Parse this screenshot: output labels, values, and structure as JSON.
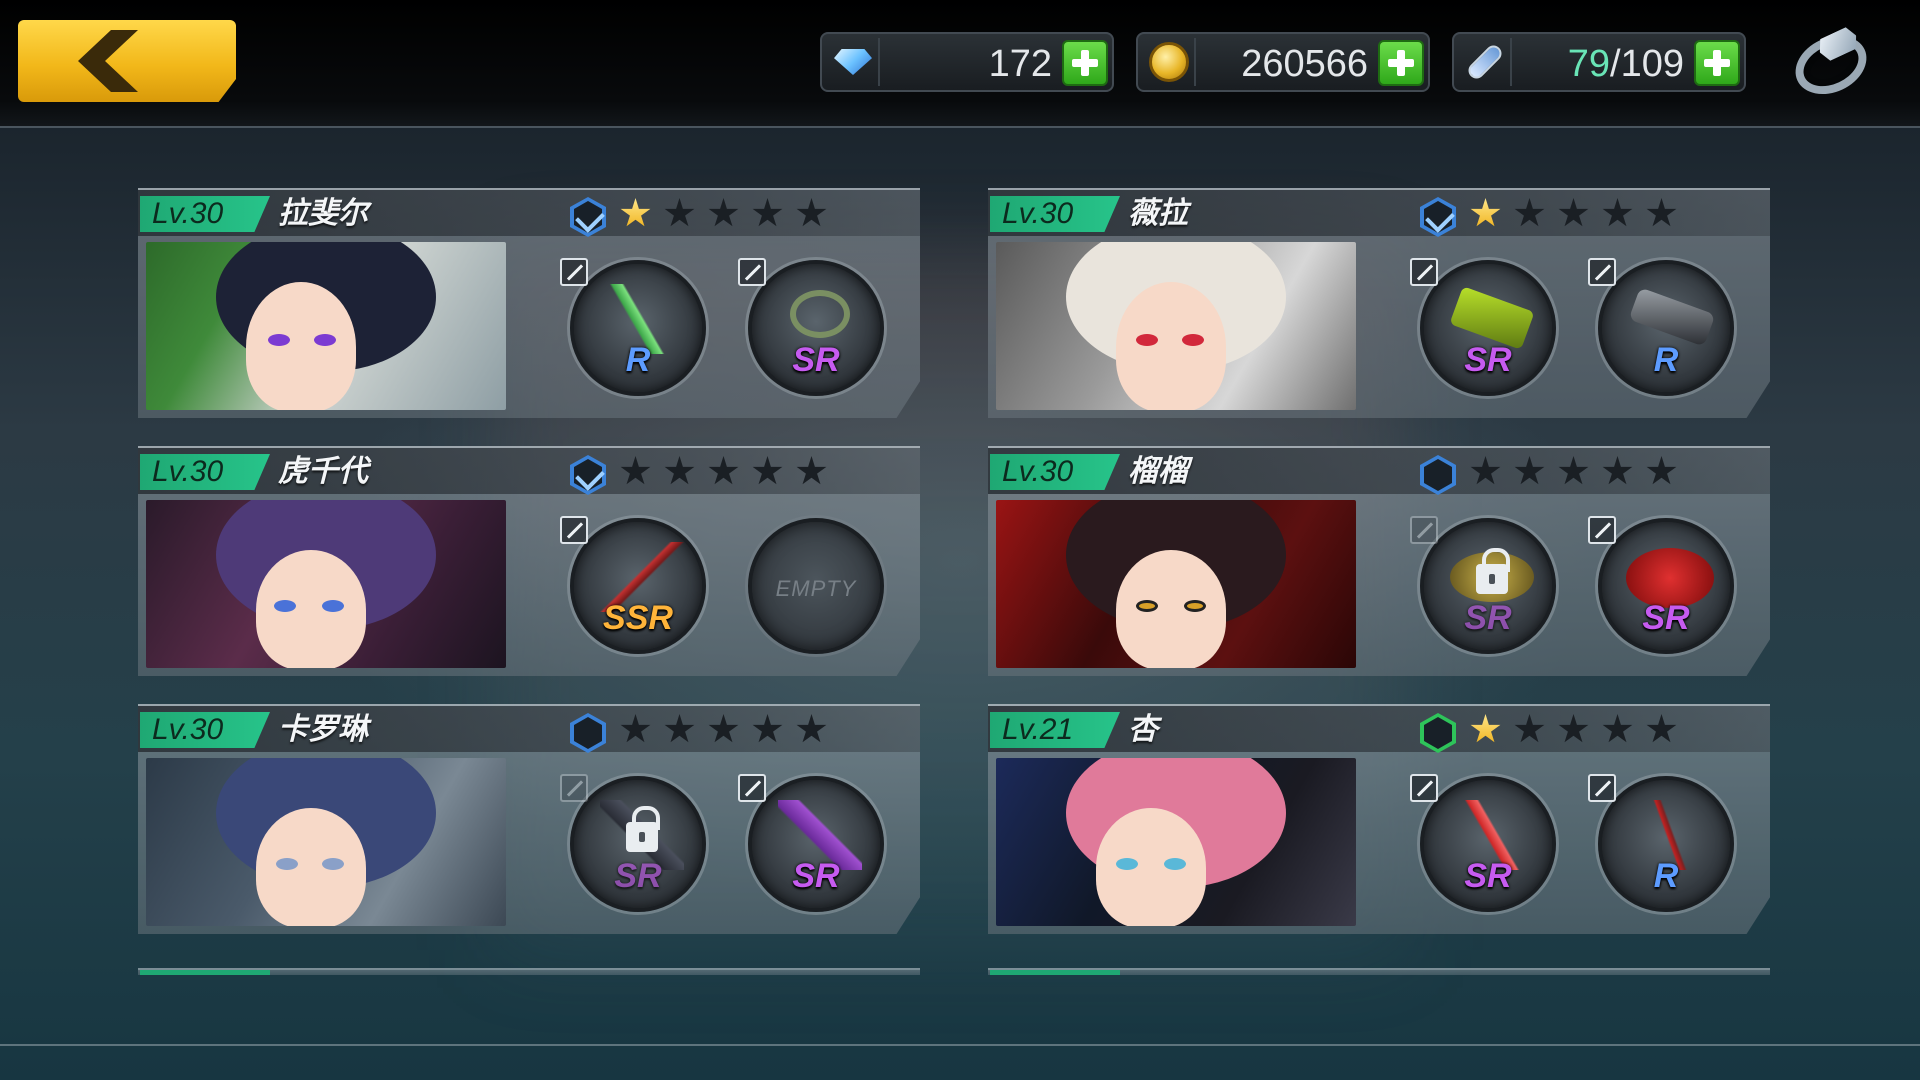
{
  "currencies": {
    "gems": "172",
    "gold": "260566",
    "stamina_current": "79",
    "stamina_sep": "/109"
  },
  "characters": [
    {
      "level": "Lv.30",
      "name": "拉斐尔",
      "stars": 1,
      "slot1_rarity": "R",
      "slot2_rarity": "SR"
    },
    {
      "level": "Lv.30",
      "name": "薇拉",
      "stars": 1,
      "slot1_rarity": "SR",
      "slot2_rarity": "R"
    },
    {
      "level": "Lv.30",
      "name": "虎千代",
      "stars": 0,
      "slot1_rarity": "SSR",
      "slot2_label": "EMPTY"
    },
    {
      "level": "Lv.30",
      "name": "榴榴",
      "stars": 0,
      "slot1_rarity": "SR",
      "slot2_rarity": "SR"
    },
    {
      "level": "Lv.30",
      "name": "卡罗琳",
      "stars": 0,
      "slot1_rarity": "SR",
      "slot2_rarity": "SR"
    },
    {
      "level": "Lv.21",
      "name": "杏",
      "stars": 1,
      "slot1_rarity": "SR",
      "slot2_rarity": "R"
    }
  ],
  "colors": {
    "accent_green": "#1fa873",
    "back_yellow": "#f2b81a",
    "rarity_r": "#5d9cff",
    "rarity_sr": "#c65bf0",
    "rarity_ssr": "#ffb43a"
  }
}
